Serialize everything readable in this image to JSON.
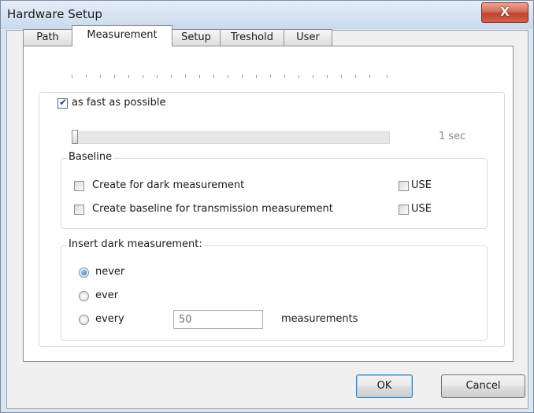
{
  "window": {
    "title": "Hardware Setup",
    "close_glyph": "X"
  },
  "tabs": [
    {
      "label": "Path"
    },
    {
      "label": "Measurement",
      "active": true
    },
    {
      "label": "Setup"
    },
    {
      "label": "Treshold"
    },
    {
      "label": "User"
    }
  ],
  "speed": {
    "fast_label": "as fast as possible",
    "fast_checked": true,
    "slider_value_label": "1 sec",
    "slider_position": 0
  },
  "baseline": {
    "legend": "Baseline",
    "create_dark_label": "Create for dark measurement",
    "create_dark_checked": false,
    "use_dark_label": "USE",
    "use_dark_checked": false,
    "create_transmission_label": "Create baseline for transmission measurement",
    "create_transmission_checked": false,
    "use_transmission_label": "USE",
    "use_transmission_checked": false
  },
  "insert_dark": {
    "legend": "Insert dark measurement:",
    "options": [
      {
        "label": "never",
        "selected": true
      },
      {
        "label": "ever",
        "selected": false
      },
      {
        "label": "every",
        "selected": false
      }
    ],
    "every_value": "50",
    "measurements_label": "measurements"
  },
  "buttons": {
    "ok_label": "OK",
    "cancel_label": "Cancel"
  }
}
